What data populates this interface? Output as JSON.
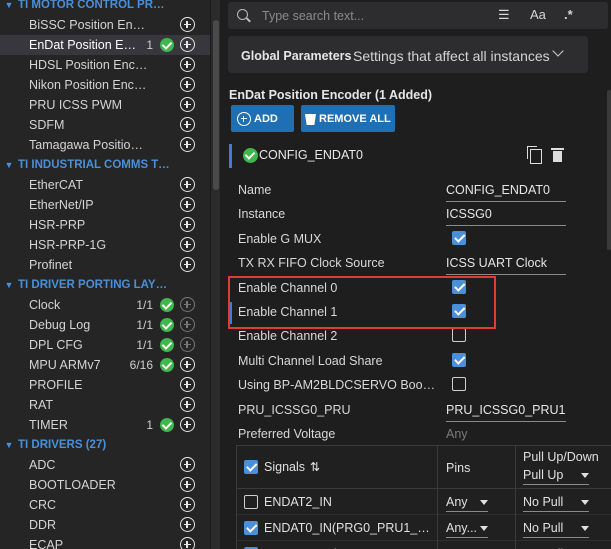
{
  "sidebar": {
    "rows": [
      {
        "type": "cat",
        "label": "TI MOTOR CONTROL PROTO..."
      },
      {
        "type": "item",
        "label": "BiSSC Position Encoder",
        "count": "",
        "ok": false,
        "selected": false,
        "add_disabled": false
      },
      {
        "type": "item",
        "label": "EnDat Position Encoder",
        "count": "1",
        "ok": true,
        "selected": true,
        "add_disabled": false
      },
      {
        "type": "item",
        "label": "HDSL Position Encoder",
        "count": "",
        "ok": false,
        "selected": false,
        "add_disabled": false
      },
      {
        "type": "item",
        "label": "Nikon Position Encoder",
        "count": "",
        "ok": false,
        "selected": false,
        "add_disabled": false
      },
      {
        "type": "item",
        "label": "PRU ICSS PWM",
        "count": "",
        "ok": false,
        "selected": false,
        "add_disabled": false
      },
      {
        "type": "item",
        "label": "SDFM",
        "count": "",
        "ok": false,
        "selected": false,
        "add_disabled": false
      },
      {
        "type": "item",
        "label": "Tamagawa Position Encoder",
        "count": "",
        "ok": false,
        "selected": false,
        "add_disabled": false
      },
      {
        "type": "cat",
        "label": "TI INDUSTRIAL COMMS TOOLKIT"
      },
      {
        "type": "item",
        "label": "EtherCAT",
        "count": "",
        "ok": false,
        "selected": false,
        "add_disabled": false
      },
      {
        "type": "item",
        "label": "EtherNet/IP",
        "count": "",
        "ok": false,
        "selected": false,
        "add_disabled": false
      },
      {
        "type": "item",
        "label": "HSR-PRP",
        "count": "",
        "ok": false,
        "selected": false,
        "add_disabled": false
      },
      {
        "type": "item",
        "label": "HSR-PRP-1G",
        "count": "",
        "ok": false,
        "selected": false,
        "add_disabled": false
      },
      {
        "type": "item",
        "label": "Profinet",
        "count": "",
        "ok": false,
        "selected": false,
        "add_disabled": false
      },
      {
        "type": "cat",
        "label": "TI DRIVER PORTING LAYER (DPL)"
      },
      {
        "type": "item",
        "label": "Clock",
        "count": "1/1",
        "ok": true,
        "selected": false,
        "add_disabled": true
      },
      {
        "type": "item",
        "label": "Debug Log",
        "count": "1/1",
        "ok": true,
        "selected": false,
        "add_disabled": true
      },
      {
        "type": "item",
        "label": "DPL CFG",
        "count": "1/1",
        "ok": true,
        "selected": false,
        "add_disabled": true
      },
      {
        "type": "item",
        "label": "MPU ARMv7",
        "count": "6/16",
        "ok": true,
        "selected": false,
        "add_disabled": false
      },
      {
        "type": "item",
        "label": "PROFILE",
        "count": "",
        "ok": false,
        "selected": false,
        "add_disabled": false
      },
      {
        "type": "item",
        "label": "RAT",
        "count": "",
        "ok": false,
        "selected": false,
        "add_disabled": false
      },
      {
        "type": "item",
        "label": "TIMER",
        "count": "1",
        "ok": true,
        "selected": false,
        "add_disabled": false
      },
      {
        "type": "cat",
        "label": "TI DRIVERS (27)"
      },
      {
        "type": "item",
        "label": "ADC",
        "count": "",
        "ok": false,
        "selected": false,
        "add_disabled": false
      },
      {
        "type": "item",
        "label": "BOOTLOADER",
        "count": "",
        "ok": false,
        "selected": false,
        "add_disabled": false
      },
      {
        "type": "item",
        "label": "CRC",
        "count": "",
        "ok": false,
        "selected": false,
        "add_disabled": false
      },
      {
        "type": "item",
        "label": "DDR",
        "count": "",
        "ok": false,
        "selected": false,
        "add_disabled": false
      },
      {
        "type": "item",
        "label": "ECAP",
        "count": "",
        "ok": false,
        "selected": false,
        "add_disabled": false
      }
    ]
  },
  "toolbar": {
    "search_placeholder": "Type search text...",
    "font_label": "Aa",
    "wildcard_label": ".*"
  },
  "global": {
    "title": "Global Parameters",
    "description": "Settings that affect all instances"
  },
  "module": {
    "title": "EnDat Position Encoder (1 Added)",
    "add_label": "ADD",
    "remove_label": "REMOVE ALL",
    "instance_name": "CONFIG_ENDAT0"
  },
  "properties": [
    {
      "label": "Name",
      "kind": "text",
      "value": "CONFIG_ENDAT0"
    },
    {
      "label": "Instance",
      "kind": "text",
      "value": "ICSSG0"
    },
    {
      "label": "Enable G MUX",
      "kind": "check",
      "checked": true
    },
    {
      "label": "TX RX FIFO Clock Source",
      "kind": "text",
      "value": "ICSS UART Clock"
    },
    {
      "label": "Enable Channel 0",
      "kind": "check",
      "checked": true
    },
    {
      "label": "Enable Channel 1",
      "kind": "check",
      "checked": true,
      "focused": true
    },
    {
      "label": "Enable Channel 2",
      "kind": "check",
      "checked": false
    },
    {
      "label": "Multi Channel Load Share",
      "kind": "check",
      "checked": true
    },
    {
      "label": "Using BP-AM2BLDCSERVO Booster Pack",
      "kind": "check",
      "checked": false
    },
    {
      "label": "PRU_ICSSG0_PRU",
      "kind": "text",
      "value": "PRU_ICSSG0_PRU1"
    },
    {
      "label": "Preferred Voltage",
      "kind": "placeholder",
      "value": "Any"
    }
  ],
  "signals": {
    "header_label": "Signals",
    "pins_label": "Pins",
    "pull_label": "Pull Up/Down",
    "pull_value": "Pull Up",
    "rows": [
      {
        "name": "ENDAT2_IN",
        "checked": false,
        "pin": "Any",
        "pull": "No Pull"
      },
      {
        "name": "ENDAT0_IN(PRG0_PRU1_GPI...",
        "checked": true,
        "pin": "Any...",
        "pull": "No Pull"
      },
      {
        "name": "ENDAT1_IN(PRG0_PRU1_GPI...",
        "checked": true,
        "pin": "Any...",
        "pull": "No Pull"
      }
    ]
  }
}
